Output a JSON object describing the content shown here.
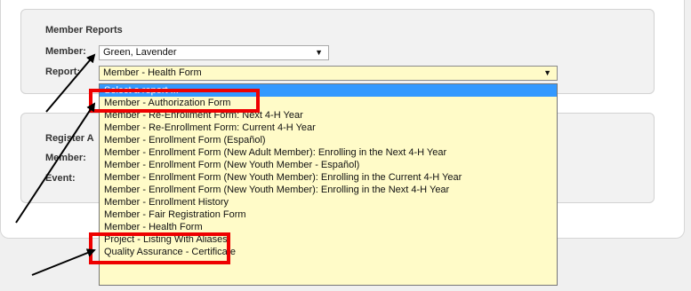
{
  "member_reports": {
    "title": "Member Reports",
    "member_label": "Member:",
    "member_value": "Green, Lavender",
    "report_label": "Report:",
    "report_value": "Member - Health Form",
    "dropdown_arrow": "▼"
  },
  "register": {
    "title": "Register A",
    "member_label": "Member:",
    "event_label": "Event:"
  },
  "dropdown": {
    "options": [
      "Select a report ...",
      "Member - Authorization Form",
      "Member - Re-Enrollment Form: Next 4-H Year",
      "Member - Re-Enrollment Form: Current 4-H Year",
      "Member - Enrollment Form (Español)",
      "Member - Enrollment Form (New Adult Member): Enrolling in the Next 4-H Year",
      "Member - Enrollment Form (New Youth Member - Español)",
      "Member - Enrollment Form (New Youth Member): Enrolling in the Current 4-H Year",
      "Member - Enrollment Form (New Youth Member): Enrolling in the Next 4-H Year",
      "Member - Enrollment History",
      "Member - Fair Registration Form",
      "Member - Health Form",
      "Project - Listing With Aliases",
      "Quality Assurance - Certificate"
    ],
    "selected_index": 0
  },
  "colors": {
    "highlight": "#ee0000",
    "selected_option": "#3399ff",
    "report_bg": "#fffbc8"
  }
}
